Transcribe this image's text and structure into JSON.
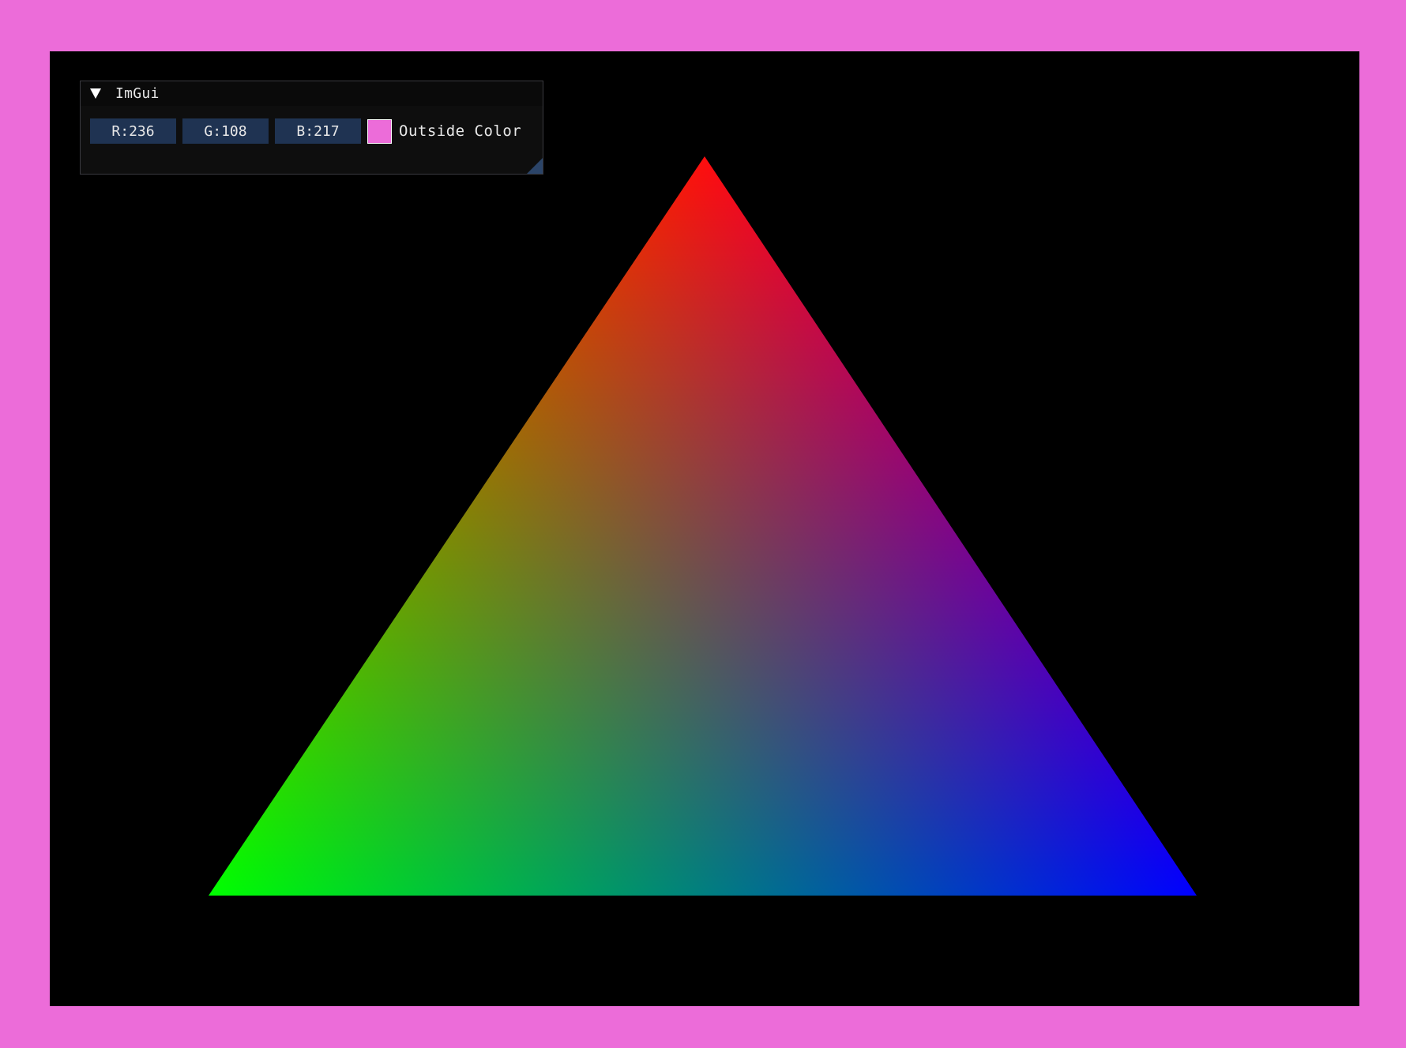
{
  "outside_color": "#ec6cd9",
  "viewport_background": "#000000",
  "triangle": {
    "vertex_colors": {
      "top": "#ff0000",
      "bottom_left": "#00ff00",
      "bottom_right": "#0000ff"
    }
  },
  "imgui": {
    "title": "ImGui",
    "collapse_icon": "triangle-down-icon",
    "fields": {
      "r_label": "R:236",
      "g_label": "G:108",
      "b_label": "B:217"
    },
    "swatch_color": "#ec6cd9",
    "color_label": "Outside Color",
    "field_background": "#1f3352"
  }
}
